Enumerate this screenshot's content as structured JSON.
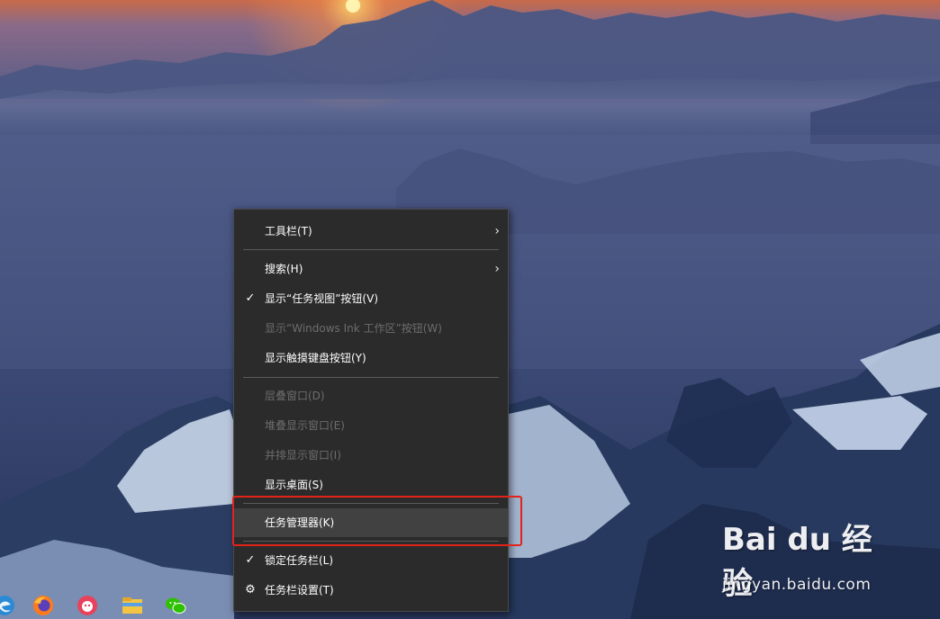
{
  "context_menu": {
    "items": [
      {
        "label": "工具栏(T)",
        "disabled": false,
        "check": "",
        "submenu": true
      },
      {
        "label": "搜索(H)",
        "disabled": false,
        "check": "",
        "submenu": true
      },
      {
        "label": "显示“任务视图”按钮(V)",
        "disabled": false,
        "check": "✓",
        "submenu": false
      },
      {
        "label": "显示“Windows Ink 工作区”按钮(W)",
        "disabled": true,
        "check": "",
        "submenu": false
      },
      {
        "label": "显示触摸键盘按钮(Y)",
        "disabled": false,
        "check": "",
        "submenu": false
      },
      {
        "label": "层叠窗口(D)",
        "disabled": true,
        "check": "",
        "submenu": false
      },
      {
        "label": "堆叠显示窗口(E)",
        "disabled": true,
        "check": "",
        "submenu": false
      },
      {
        "label": "并排显示窗口(I)",
        "disabled": true,
        "check": "",
        "submenu": false
      },
      {
        "label": "显示桌面(S)",
        "disabled": false,
        "check": "",
        "submenu": false
      },
      {
        "label": "任务管理器(K)",
        "disabled": false,
        "check": "",
        "submenu": false,
        "hovered": true
      },
      {
        "label": "锁定任务栏(L)",
        "disabled": false,
        "check": "✓",
        "submenu": false
      },
      {
        "label": "任务栏设置(T)",
        "disabled": false,
        "check": "⚙",
        "submenu": false
      }
    ],
    "submenu_glyph": "›"
  },
  "taskbar": {
    "icons": [
      "edge-icon",
      "firefox-icon",
      "app-icon",
      "file-explorer-icon",
      "wechat-icon"
    ]
  },
  "watermark": {
    "brand": "Bai du 经验",
    "url": "jingyan.baidu.com"
  },
  "colors": {
    "menu_bg": "#2b2b2b",
    "menu_hover": "#414141",
    "highlight_border": "#e2231a",
    "disabled_text": "#6d6d6d"
  }
}
